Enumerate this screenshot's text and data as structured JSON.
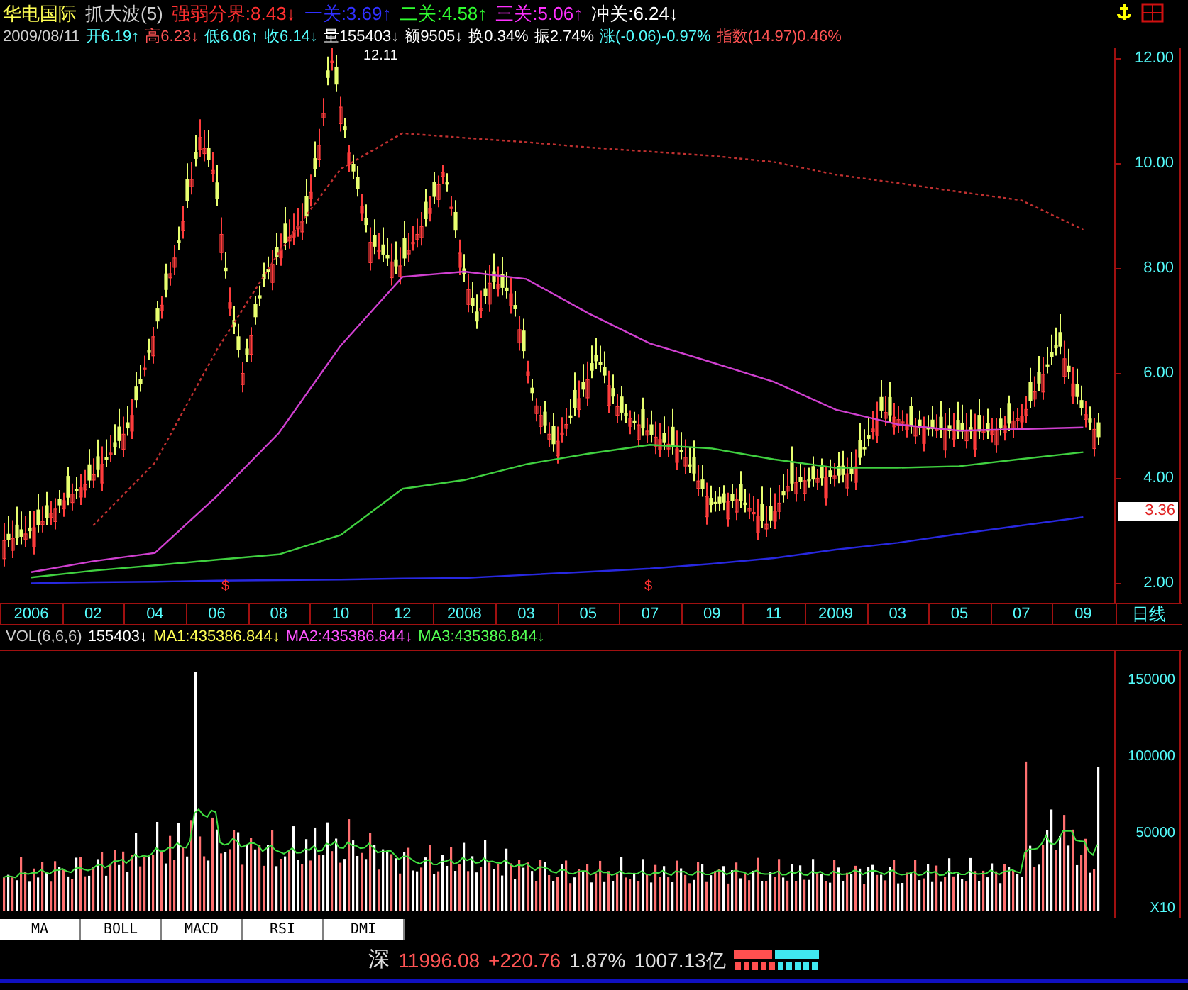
{
  "header": {
    "security": "华电国际",
    "indicator": "抓大波(5)",
    "levels": [
      {
        "label": "强弱分界:8.43",
        "arrow": "↓",
        "color": "#ff3030"
      },
      {
        "label": "一关:3.69",
        "arrow": "↑",
        "color": "#3030ff"
      },
      {
        "label": "二关:4.58",
        "arrow": "↑",
        "color": "#30ff30"
      },
      {
        "label": "三关:5.06",
        "arrow": "↑",
        "color": "#ff30ff"
      },
      {
        "label": "冲关:6.24",
        "arrow": "↓",
        "color": "#ffffff"
      }
    ]
  },
  "quote": {
    "date": "2009/08/11",
    "items": [
      {
        "text": "开6.19",
        "arrow": "↑",
        "color": "#54fcfc"
      },
      {
        "text": "高6.23",
        "arrow": "↓",
        "color": "#ff5454"
      },
      {
        "text": "低6.06",
        "arrow": "↑",
        "color": "#54fcfc"
      },
      {
        "text": "收6.14",
        "arrow": "↓",
        "color": "#54fcfc"
      },
      {
        "text": "量155403",
        "arrow": "↓",
        "color": "#ffffff"
      },
      {
        "text": "额9505",
        "arrow": "↓",
        "color": "#ffffff"
      },
      {
        "text": "换0.34%",
        "color": "#ffffff"
      },
      {
        "text": "振2.74%",
        "color": "#ffffff"
      },
      {
        "text": "涨(-0.06)-0.97%",
        "color": "#54fcfc"
      },
      {
        "text": "指数(14.97)0.46%",
        "color": "#ff5454"
      }
    ]
  },
  "price_pane": {
    "peak_label": "12.11",
    "last_price": "3.36",
    "markers": [
      "$",
      "$"
    ],
    "period": "日线",
    "chart_data": {
      "type": "line",
      "categories": [
        "2006",
        "02",
        "04",
        "06",
        "08",
        "10",
        "12",
        "2008",
        "03",
        "05",
        "07",
        "09",
        "11",
        "2009",
        "03",
        "05",
        "07",
        "09"
      ],
      "ylim": [
        1.6,
        12.2
      ],
      "yticks": [
        {
          "value": 12,
          "label": "12.00"
        },
        {
          "value": 10,
          "label": "10.00"
        },
        {
          "value": 8,
          "label": "8.00"
        },
        {
          "value": 6,
          "label": "6.00"
        },
        {
          "value": 4,
          "label": "4.00"
        },
        {
          "value": 2,
          "label": "2.00"
        }
      ],
      "series": [
        {
          "color": "#c03030",
          "line_style": "dashed",
          "values": [
            null,
            3.1,
            4.3,
            6.45,
            8.3,
            9.9,
            10.58,
            10.49,
            10.41,
            10.31,
            10.23,
            10.15,
            10.03,
            9.79,
            9.63,
            9.46,
            9.3,
            8.74
          ]
        },
        {
          "color": "#d040d0",
          "values": [
            2.21,
            2.42,
            2.58,
            3.66,
            4.86,
            6.53,
            7.84,
            7.94,
            7.8,
            7.15,
            6.57,
            6.21,
            5.84,
            5.31,
            5.03,
            4.91,
            4.94,
            4.97
          ]
        },
        {
          "color": "#40d040",
          "values": [
            2.11,
            2.24,
            2.34,
            2.45,
            2.55,
            2.92,
            3.8,
            3.97,
            4.27,
            4.47,
            4.64,
            4.57,
            4.36,
            4.2,
            4.2,
            4.23,
            4.37,
            4.5
          ]
        },
        {
          "color": "#2828e0",
          "values": [
            2.0,
            2.02,
            2.03,
            2.05,
            2.06,
            2.07,
            2.09,
            2.1,
            2.16,
            2.22,
            2.28,
            2.37,
            2.48,
            2.64,
            2.77,
            2.94,
            3.1,
            3.26
          ]
        }
      ]
    }
  },
  "volume_pane": {
    "name": "VOL(6,6,6)",
    "value": "155403",
    "value_arrow": "↓",
    "averages": [
      {
        "label": "MA1:435386.844",
        "arrow": "↓",
        "color": "#ffff54"
      },
      {
        "label": "MA2:435386.844",
        "arrow": "↓",
        "color": "#ff54ff"
      },
      {
        "label": "MA3:435386.844",
        "arrow": "↓",
        "color": "#54ff54"
      }
    ],
    "yticks": [
      "150000",
      "100000",
      "50000"
    ],
    "unit": "X10"
  },
  "indicator_tabs": [
    "MA",
    "BOLL",
    "MACD",
    "RSI",
    "DMI"
  ],
  "status_bar": {
    "market": "深",
    "index": "11996.08",
    "change": "+220.76",
    "percent": "1.87%",
    "turnover": "1007.13亿"
  }
}
